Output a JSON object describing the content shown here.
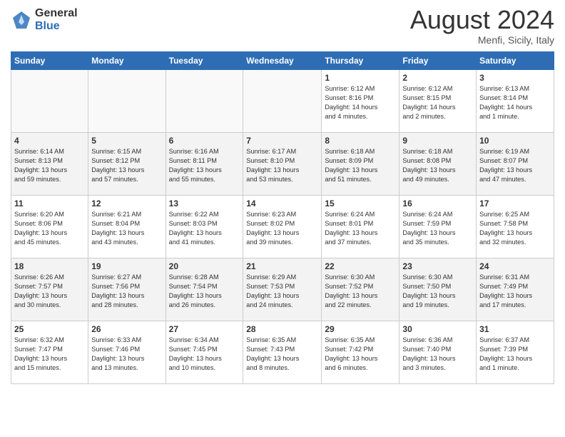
{
  "logo": {
    "general": "General",
    "blue": "Blue"
  },
  "title": "August 2024",
  "location": "Menfi, Sicily, Italy",
  "days_of_week": [
    "Sunday",
    "Monday",
    "Tuesday",
    "Wednesday",
    "Thursday",
    "Friday",
    "Saturday"
  ],
  "weeks": [
    [
      {
        "num": "",
        "info": ""
      },
      {
        "num": "",
        "info": ""
      },
      {
        "num": "",
        "info": ""
      },
      {
        "num": "",
        "info": ""
      },
      {
        "num": "1",
        "info": "Sunrise: 6:12 AM\nSunset: 8:16 PM\nDaylight: 14 hours\nand 4 minutes."
      },
      {
        "num": "2",
        "info": "Sunrise: 6:12 AM\nSunset: 8:15 PM\nDaylight: 14 hours\nand 2 minutes."
      },
      {
        "num": "3",
        "info": "Sunrise: 6:13 AM\nSunset: 8:14 PM\nDaylight: 14 hours\nand 1 minute."
      }
    ],
    [
      {
        "num": "4",
        "info": "Sunrise: 6:14 AM\nSunset: 8:13 PM\nDaylight: 13 hours\nand 59 minutes."
      },
      {
        "num": "5",
        "info": "Sunrise: 6:15 AM\nSunset: 8:12 PM\nDaylight: 13 hours\nand 57 minutes."
      },
      {
        "num": "6",
        "info": "Sunrise: 6:16 AM\nSunset: 8:11 PM\nDaylight: 13 hours\nand 55 minutes."
      },
      {
        "num": "7",
        "info": "Sunrise: 6:17 AM\nSunset: 8:10 PM\nDaylight: 13 hours\nand 53 minutes."
      },
      {
        "num": "8",
        "info": "Sunrise: 6:18 AM\nSunset: 8:09 PM\nDaylight: 13 hours\nand 51 minutes."
      },
      {
        "num": "9",
        "info": "Sunrise: 6:18 AM\nSunset: 8:08 PM\nDaylight: 13 hours\nand 49 minutes."
      },
      {
        "num": "10",
        "info": "Sunrise: 6:19 AM\nSunset: 8:07 PM\nDaylight: 13 hours\nand 47 minutes."
      }
    ],
    [
      {
        "num": "11",
        "info": "Sunrise: 6:20 AM\nSunset: 8:06 PM\nDaylight: 13 hours\nand 45 minutes."
      },
      {
        "num": "12",
        "info": "Sunrise: 6:21 AM\nSunset: 8:04 PM\nDaylight: 13 hours\nand 43 minutes."
      },
      {
        "num": "13",
        "info": "Sunrise: 6:22 AM\nSunset: 8:03 PM\nDaylight: 13 hours\nand 41 minutes."
      },
      {
        "num": "14",
        "info": "Sunrise: 6:23 AM\nSunset: 8:02 PM\nDaylight: 13 hours\nand 39 minutes."
      },
      {
        "num": "15",
        "info": "Sunrise: 6:24 AM\nSunset: 8:01 PM\nDaylight: 13 hours\nand 37 minutes."
      },
      {
        "num": "16",
        "info": "Sunrise: 6:24 AM\nSunset: 7:59 PM\nDaylight: 13 hours\nand 35 minutes."
      },
      {
        "num": "17",
        "info": "Sunrise: 6:25 AM\nSunset: 7:58 PM\nDaylight: 13 hours\nand 32 minutes."
      }
    ],
    [
      {
        "num": "18",
        "info": "Sunrise: 6:26 AM\nSunset: 7:57 PM\nDaylight: 13 hours\nand 30 minutes."
      },
      {
        "num": "19",
        "info": "Sunrise: 6:27 AM\nSunset: 7:56 PM\nDaylight: 13 hours\nand 28 minutes."
      },
      {
        "num": "20",
        "info": "Sunrise: 6:28 AM\nSunset: 7:54 PM\nDaylight: 13 hours\nand 26 minutes."
      },
      {
        "num": "21",
        "info": "Sunrise: 6:29 AM\nSunset: 7:53 PM\nDaylight: 13 hours\nand 24 minutes."
      },
      {
        "num": "22",
        "info": "Sunrise: 6:30 AM\nSunset: 7:52 PM\nDaylight: 13 hours\nand 22 minutes."
      },
      {
        "num": "23",
        "info": "Sunrise: 6:30 AM\nSunset: 7:50 PM\nDaylight: 13 hours\nand 19 minutes."
      },
      {
        "num": "24",
        "info": "Sunrise: 6:31 AM\nSunset: 7:49 PM\nDaylight: 13 hours\nand 17 minutes."
      }
    ],
    [
      {
        "num": "25",
        "info": "Sunrise: 6:32 AM\nSunset: 7:47 PM\nDaylight: 13 hours\nand 15 minutes."
      },
      {
        "num": "26",
        "info": "Sunrise: 6:33 AM\nSunset: 7:46 PM\nDaylight: 13 hours\nand 13 minutes."
      },
      {
        "num": "27",
        "info": "Sunrise: 6:34 AM\nSunset: 7:45 PM\nDaylight: 13 hours\nand 10 minutes."
      },
      {
        "num": "28",
        "info": "Sunrise: 6:35 AM\nSunset: 7:43 PM\nDaylight: 13 hours\nand 8 minutes."
      },
      {
        "num": "29",
        "info": "Sunrise: 6:35 AM\nSunset: 7:42 PM\nDaylight: 13 hours\nand 6 minutes."
      },
      {
        "num": "30",
        "info": "Sunrise: 6:36 AM\nSunset: 7:40 PM\nDaylight: 13 hours\nand 3 minutes."
      },
      {
        "num": "31",
        "info": "Sunrise: 6:37 AM\nSunset: 7:39 PM\nDaylight: 13 hours\nand 1 minute."
      }
    ]
  ]
}
